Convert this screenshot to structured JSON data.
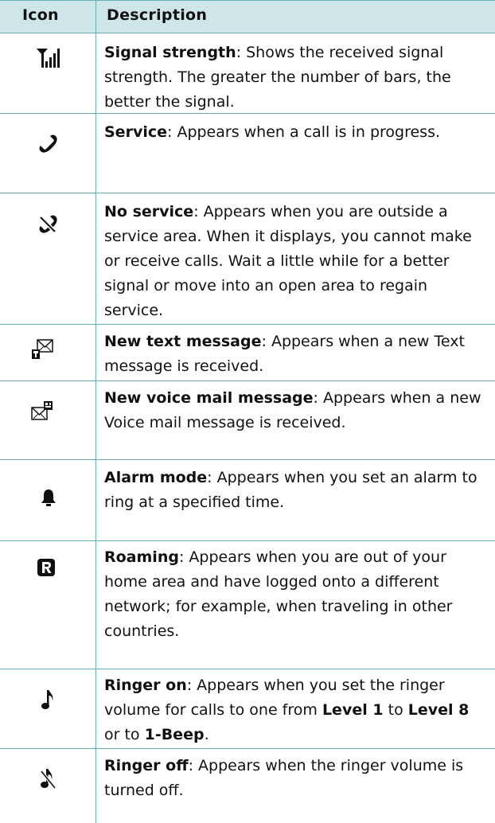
{
  "header": {
    "icon_col": "Icon",
    "desc_col": "Description"
  },
  "rows": [
    {
      "icon": "signal-strength-icon",
      "title": "Signal strength",
      "text": ": Shows the received signal strength. The greater the number of bars, the better the signal."
    },
    {
      "icon": "phone-handset-icon",
      "title": "Service",
      "text": ": Appears when a call is in progress."
    },
    {
      "icon": "no-service-icon",
      "title": "No service",
      "text": ": Appears when you are outside a service area. When it displays, you cannot make or receive calls. Wait a little while for a better signal or move into an open area to regain service."
    },
    {
      "icon": "new-text-message-icon",
      "title": "New text message",
      "text": ": Appears when a new Text message is received."
    },
    {
      "icon": "new-voice-mail-icon",
      "title": "New voice mail message",
      "text": ": Appears when a new Voice mail message is received."
    },
    {
      "icon": "alarm-bell-icon",
      "title": "Alarm mode",
      "text": ": Appears when you set an alarm to ring at a specified time."
    },
    {
      "icon": "roaming-icon",
      "title": "Roaming",
      "text": ": Appears when you are out of your home area and have logged onto a different network; for example, when traveling in other countries."
    },
    {
      "icon": "ringer-on-icon",
      "title": "Ringer on",
      "text_a": ": Appears when you set the ringer volume for calls to one from ",
      "bold_a": "Level 1",
      "text_b": " to ",
      "bold_b": "Level 8",
      "text_c": " or to ",
      "bold_c": "1-Beep",
      "text_d": "."
    },
    {
      "icon": "ringer-off-icon",
      "title": "Ringer off",
      "text": ": Appears when the ringer volume is turned off."
    }
  ]
}
